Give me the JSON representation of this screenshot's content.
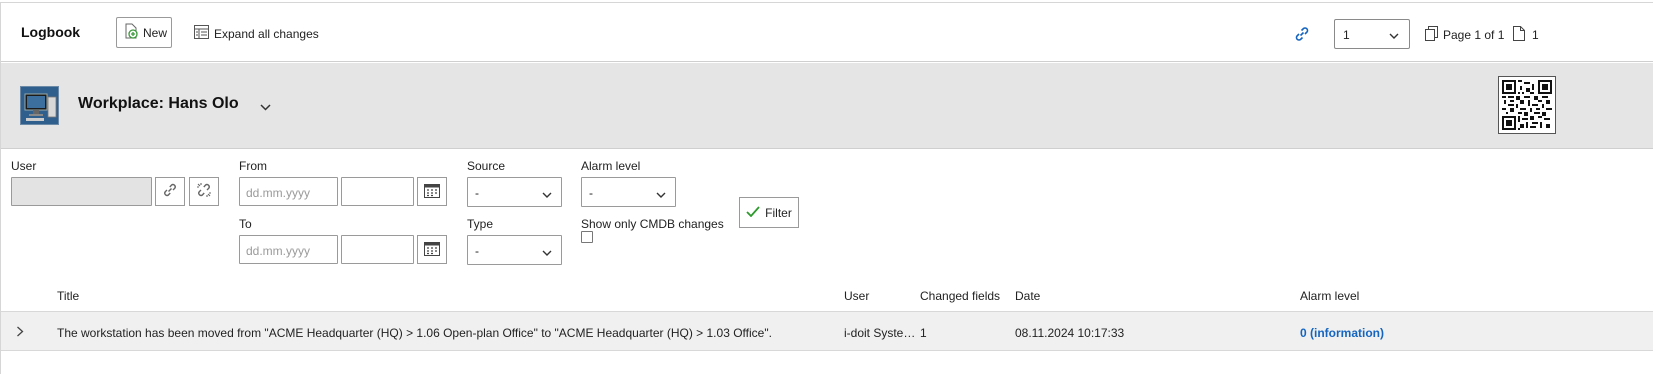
{
  "toolbar": {
    "title": "Logbook",
    "new_label": "New",
    "expand_label": "Expand all changes",
    "page_select_value": "1",
    "page_info": "Page 1 of 1",
    "page_count": "1"
  },
  "object": {
    "title": "Workplace: Hans Olo"
  },
  "filters": {
    "user_label": "User",
    "user_value": "",
    "from_label": "From",
    "to_label": "To",
    "date_placeholder": "dd.mm.yyyy",
    "source_label": "Source",
    "source_value": "-",
    "type_label": "Type",
    "type_value": "-",
    "alarm_label": "Alarm level",
    "alarm_value": "-",
    "cmdb_only_label": "Show only CMDB changes",
    "cmdb_only_checked": false,
    "filter_button": "Filter"
  },
  "table": {
    "columns": [
      "Title",
      "User",
      "Changed fields",
      "Date",
      "Alarm level"
    ],
    "rows": [
      {
        "title": "The workstation has been moved from \"ACME Headquarter (HQ) > 1.06 Open-plan Office\" to \"ACME Headquarter (HQ) > 1.03 Office\".",
        "user": "i-doit Syste…",
        "changed_fields": "1",
        "date": "08.11.2024 10:17:33",
        "alarm_level": "0 (information)"
      }
    ]
  },
  "colors": {
    "accent": "#1565c0",
    "header_bg": "#e5e5e5",
    "row_bg": "#f0f0f0"
  }
}
